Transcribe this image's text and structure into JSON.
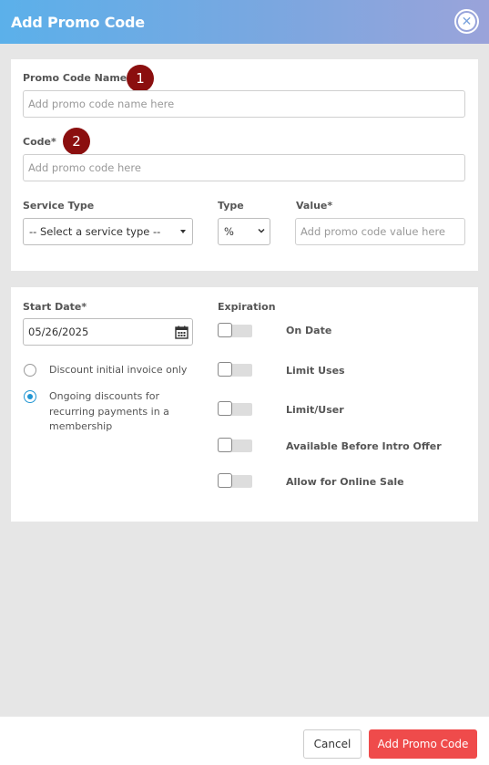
{
  "header": {
    "title": "Add Promo Code",
    "close_icon": "close-icon"
  },
  "badges": [
    "1",
    "2"
  ],
  "section1": {
    "promo_name": {
      "label": "Promo Code Name*",
      "placeholder": "Add promo code name here",
      "value": ""
    },
    "code": {
      "label": "Code*",
      "placeholder": "Add promo code here",
      "value": ""
    },
    "service_type": {
      "label": "Service Type",
      "selected": "-- Select a service type --"
    },
    "type": {
      "label": "Type",
      "selected": "%"
    },
    "value": {
      "label": "Value*",
      "placeholder": "Add promo code value here",
      "value": ""
    }
  },
  "section2": {
    "start_date": {
      "label": "Start Date*",
      "value": "05/26/2025",
      "icon": "calendar-icon"
    },
    "radios": [
      {
        "lines": [
          "Discount initial invoice only"
        ],
        "checked": false
      },
      {
        "lines": [
          "Ongoing discounts for",
          "recurring payments in a",
          "membership"
        ],
        "checked": true
      }
    ],
    "expiration_label": "Expiration",
    "toggles": [
      {
        "label": "On Date",
        "on": false
      },
      {
        "label": "Limit Uses",
        "on": false
      },
      {
        "label": "Limit/User",
        "on": false
      },
      {
        "label": "Available Before Intro Offer",
        "on": false
      },
      {
        "label": "Allow for Online Sale",
        "on": false
      }
    ]
  },
  "footer": {
    "cancel_label": "Cancel",
    "add_label": "Add Promo Code"
  },
  "colors": {
    "header_start": "#5bb0ea",
    "header_end": "#9aa3da",
    "badge": "#8b0f0f",
    "primary_button": "#ef4b4b",
    "radio_checked": "#2196d3"
  }
}
